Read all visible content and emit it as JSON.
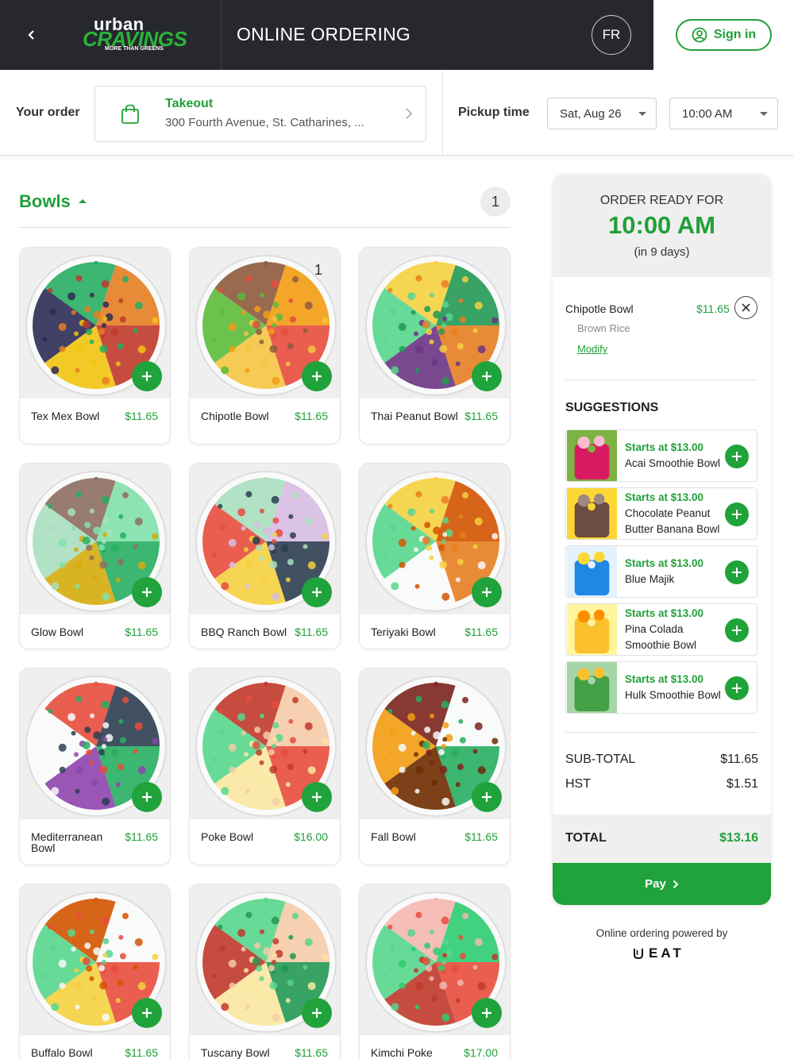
{
  "header": {
    "brand_top": "urban",
    "brand_main": "CRAVINGS",
    "brand_tagline": "MORE THAN GREENS",
    "title": "ONLINE ORDERING",
    "lang": "FR",
    "signin": "Sign in"
  },
  "order_bar": {
    "your_order_label": "Your order",
    "mode": "Takeout",
    "address": "300 Fourth Avenue, St. Catharines, ...",
    "pickup_label": "Pickup time",
    "date": "Sat, Aug 26",
    "time": "10:00 AM"
  },
  "category": {
    "title": "Bowls",
    "count": "1"
  },
  "products": [
    {
      "name": "Tex Mex Bowl",
      "price": "$11.65",
      "qty": ""
    },
    {
      "name": "Chipotle Bowl",
      "price": "$11.65",
      "qty": "1"
    },
    {
      "name": "Thai Peanut Bowl",
      "price": "$11.65",
      "qty": ""
    },
    {
      "name": "Glow Bowl",
      "price": "$11.65",
      "qty": ""
    },
    {
      "name": "BBQ Ranch Bowl",
      "price": "$11.65",
      "qty": ""
    },
    {
      "name": "Teriyaki Bowl",
      "price": "$11.65",
      "qty": ""
    },
    {
      "name": "Mediterranean Bowl",
      "price": "$11.65",
      "qty": ""
    },
    {
      "name": "Poke Bowl",
      "price": "$16.00",
      "qty": ""
    },
    {
      "name": "Fall Bowl",
      "price": "$11.65",
      "qty": ""
    },
    {
      "name": "Buffalo Bowl",
      "price": "$11.65",
      "qty": ""
    },
    {
      "name": "Tuscany Bowl",
      "price": "$11.65",
      "qty": ""
    },
    {
      "name": "Kimchi Poke Bowl",
      "price": "$17.00",
      "qty": ""
    }
  ],
  "sidebar": {
    "ready_label": "ORDER READY FOR",
    "ready_time": "10:00 AM",
    "ready_days": "(in 9 days)",
    "cart_item": {
      "name": "Chipotle Bowl",
      "price": "$11.65",
      "modifier": "Brown Rice",
      "modify": "Modify"
    },
    "suggestions_title": "SUGGESTIONS",
    "suggestions": [
      {
        "starts": "Starts at $13.00",
        "name": "Acai Smoothie Bowl"
      },
      {
        "starts": "Starts at $13.00",
        "name": "Chocolate Peanut Butter Banana Bowl"
      },
      {
        "starts": "Starts at $13.00",
        "name": "Blue Majik"
      },
      {
        "starts": "Starts at $13.00",
        "name": "Pina Colada Smoothie Bowl"
      },
      {
        "starts": "Starts at $13.00",
        "name": "Hulk Smoothie Bowl"
      }
    ],
    "subtotal_label": "SUB-TOTAL",
    "subtotal": "$11.65",
    "hst_label": "HST",
    "hst": "$1.51",
    "total_label": "TOTAL",
    "total": "$13.16",
    "pay": "Pay"
  },
  "footer": {
    "powered": "Online ordering powered by",
    "eat": "EAT"
  }
}
